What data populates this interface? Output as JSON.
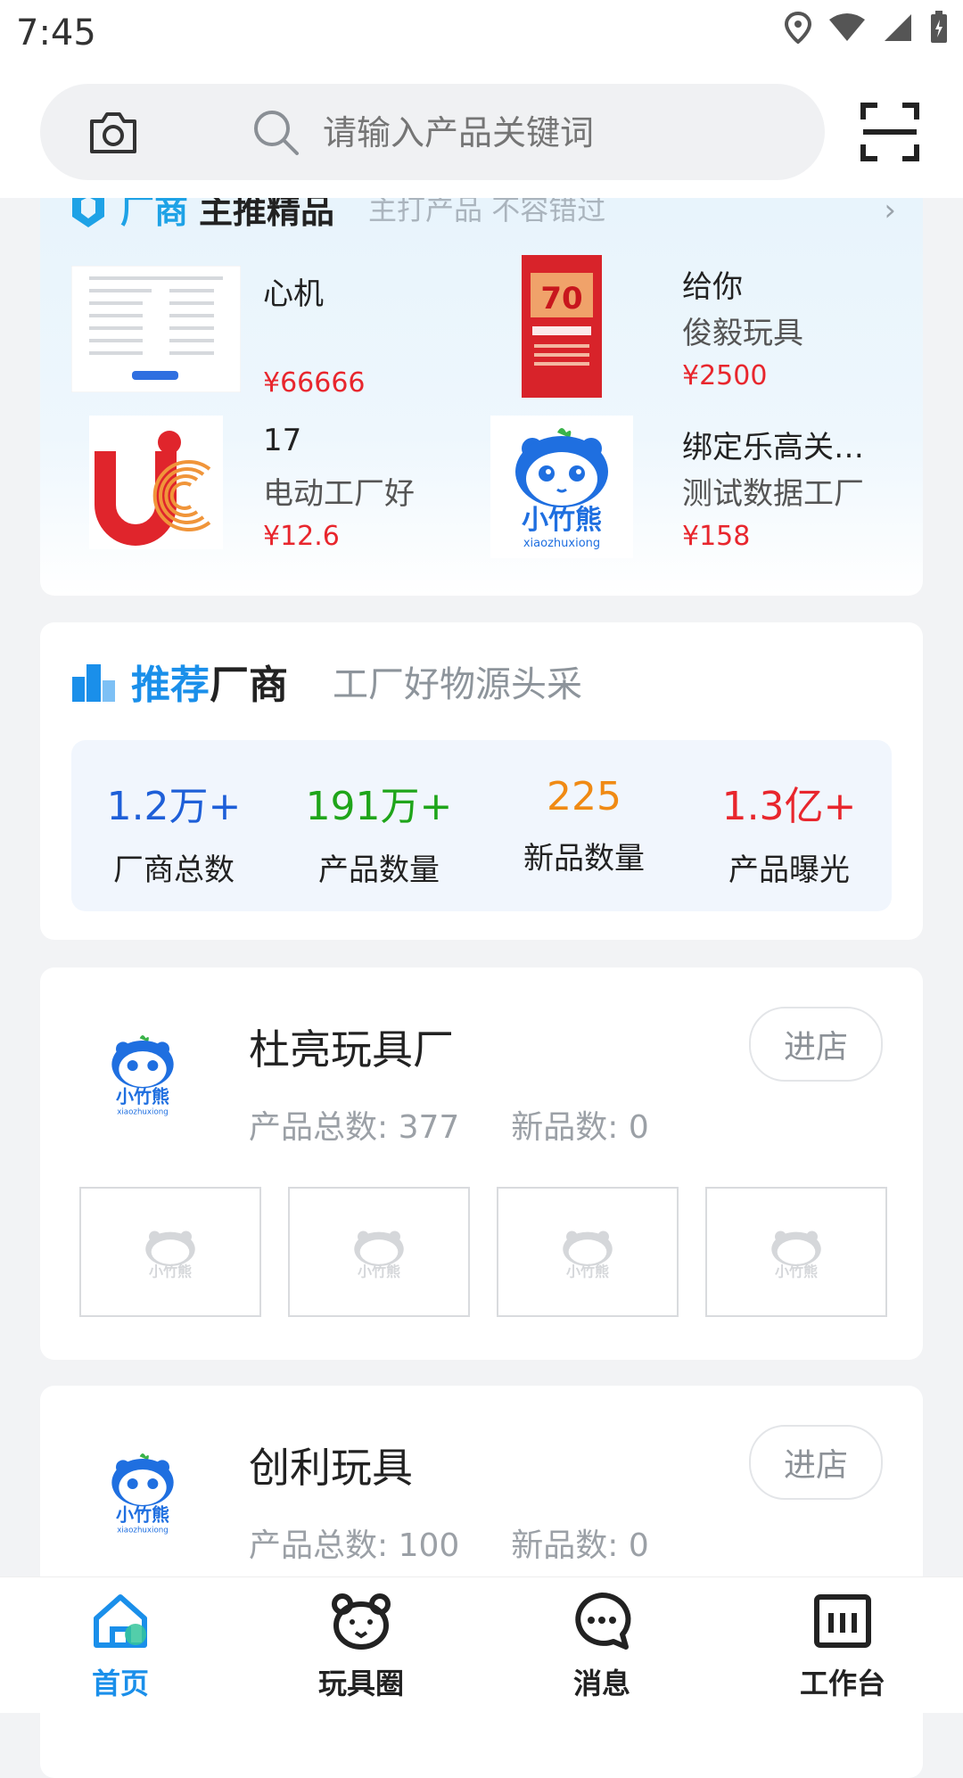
{
  "status": {
    "time": "7:45"
  },
  "search": {
    "placeholder": "请输入产品关键词"
  },
  "featured": {
    "title_a": "厂商",
    "title_b": "主推精品",
    "subtitle": "主打产品 不容错过",
    "products": [
      {
        "name": "心机",
        "sub": "",
        "price": "¥66666"
      },
      {
        "name": "给你",
        "sub": "俊毅玩具",
        "price": "¥2500"
      },
      {
        "name": "17",
        "sub": "电动工厂好",
        "price": "¥12.6"
      },
      {
        "name": "绑定乐高关…",
        "sub": "测试数据工厂",
        "price": "¥158"
      }
    ]
  },
  "recommend": {
    "title_a": "推荐",
    "title_b": "厂商",
    "subtitle": "工厂好物源头采",
    "stats": [
      {
        "value": "1.2万+",
        "label": "厂商总数",
        "color": "#1e5fd8"
      },
      {
        "value": "191万+",
        "label": "产品数量",
        "color": "#1fa51a"
      },
      {
        "value": "225",
        "label": "新品数量",
        "color": "#f08a14"
      },
      {
        "value": "1.3亿+",
        "label": "产品曝光",
        "color": "#e8262d"
      }
    ]
  },
  "shops": [
    {
      "name": "杜亮玩具厂",
      "total": "产品总数: 377",
      "new": "新品数: 0",
      "button": "进店"
    },
    {
      "name": "创利玩具",
      "total": "产品总数: 100",
      "new": "新品数: 0",
      "button": "进店"
    }
  ],
  "logo_text": {
    "cn": "小竹熊",
    "en": "xiaozhuxiong",
    "uc": "UC"
  },
  "tabs": [
    {
      "label": "首页",
      "icon": "home-icon",
      "active": true
    },
    {
      "label": "玩具圈",
      "icon": "bear-icon",
      "active": false
    },
    {
      "label": "消息",
      "icon": "message-icon",
      "active": false
    },
    {
      "label": "工作台",
      "icon": "dashboard-icon",
      "active": false
    }
  ],
  "colors": {
    "accent": "#1a8fea",
    "price": "#e8262d"
  }
}
